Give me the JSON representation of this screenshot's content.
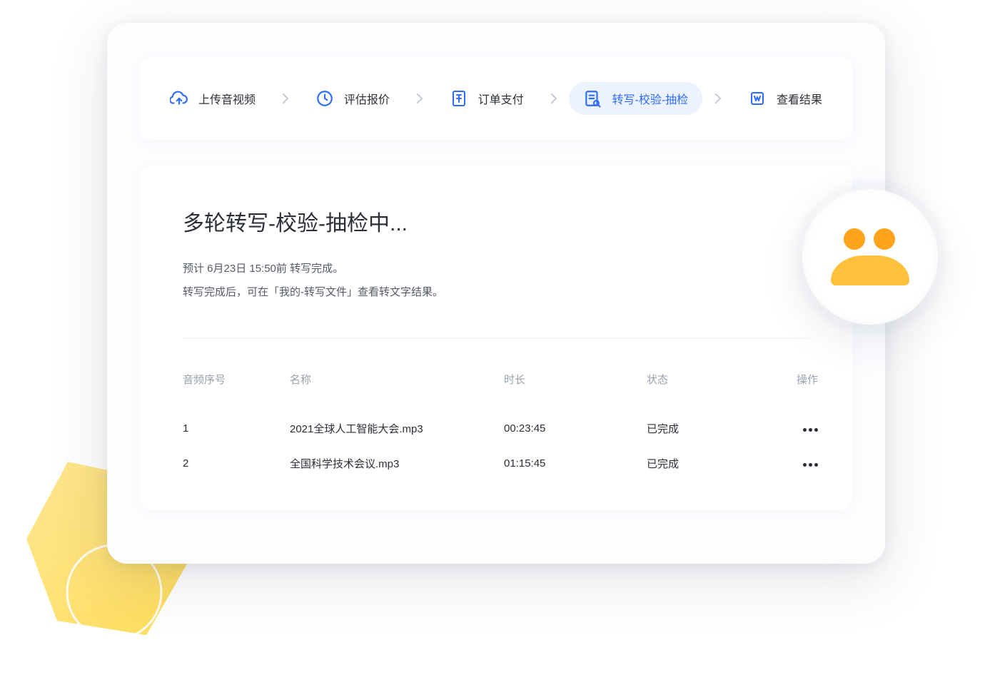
{
  "steps": [
    {
      "label": "上传音视频",
      "icon": "cloud-upload-icon",
      "active": false
    },
    {
      "label": "评估报价",
      "icon": "clock-icon",
      "active": false
    },
    {
      "label": "订单支付",
      "icon": "receipt-icon",
      "active": false
    },
    {
      "label": "转写-校验-抽检",
      "icon": "doc-check-icon",
      "active": true
    },
    {
      "label": "查看结果",
      "icon": "word-doc-icon",
      "active": false
    }
  ],
  "status": {
    "heading": "多轮转写-校验-抽检中...",
    "line1": "预计 6月23日 15:50前 转写完成。",
    "line2": "转写完成后，可在「我的-转写文件」查看转文字结果。"
  },
  "table": {
    "headers": {
      "seq": "音频序号",
      "name": "名称",
      "duration": "时长",
      "state": "状态",
      "action": "操作"
    },
    "rows": [
      {
        "seq": "1",
        "name": "2021全球人工智能大会.mp3",
        "duration": "00:23:45",
        "state": "已完成"
      },
      {
        "seq": "2",
        "name": "全国科学技术会议.mp3",
        "duration": "01:15:45",
        "state": "已完成"
      }
    ]
  }
}
